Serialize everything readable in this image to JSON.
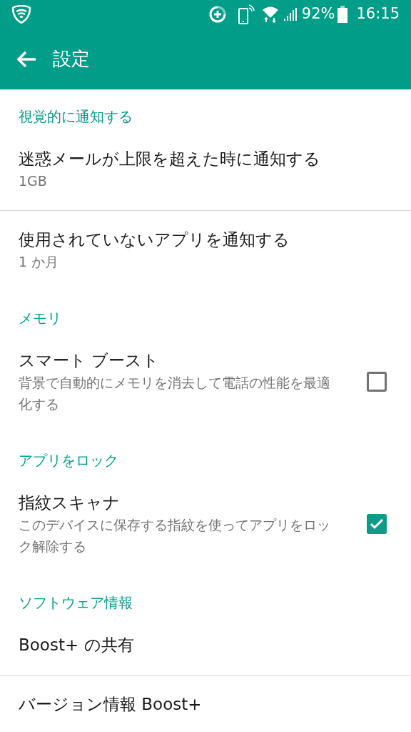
{
  "status_bar": {
    "battery": "92%",
    "time": "16:15"
  },
  "toolbar": {
    "title": "設定"
  },
  "entries": [
    {
      "kind": "header",
      "title": "視覚的に通知する"
    },
    {
      "kind": "item",
      "title": "迷惑メールが上限を超えた時に通知する",
      "summary": "1GB",
      "divider": true
    },
    {
      "kind": "item",
      "title": "使用されていないアプリを通知する",
      "summary": "1 か月",
      "divider": false
    },
    {
      "kind": "header",
      "title": "メモリ"
    },
    {
      "kind": "checkbox",
      "title": "スマート ブースト",
      "summary": "背景で自動的にメモリを消去して電話の性能を最適化する",
      "checked": false,
      "divider": false
    },
    {
      "kind": "header",
      "title": "アプリをロック"
    },
    {
      "kind": "checkbox",
      "title": "指紋スキャナ",
      "summary": "このデバイスに保存する指紋を使ってアプリをロック解除する",
      "checked": true,
      "divider": false
    },
    {
      "kind": "header",
      "title": "ソフトウェア情報"
    },
    {
      "kind": "item",
      "title": "Boost+ の共有",
      "divider": true
    },
    {
      "kind": "item",
      "title": "バージョン情報 Boost+",
      "divider": false
    }
  ]
}
